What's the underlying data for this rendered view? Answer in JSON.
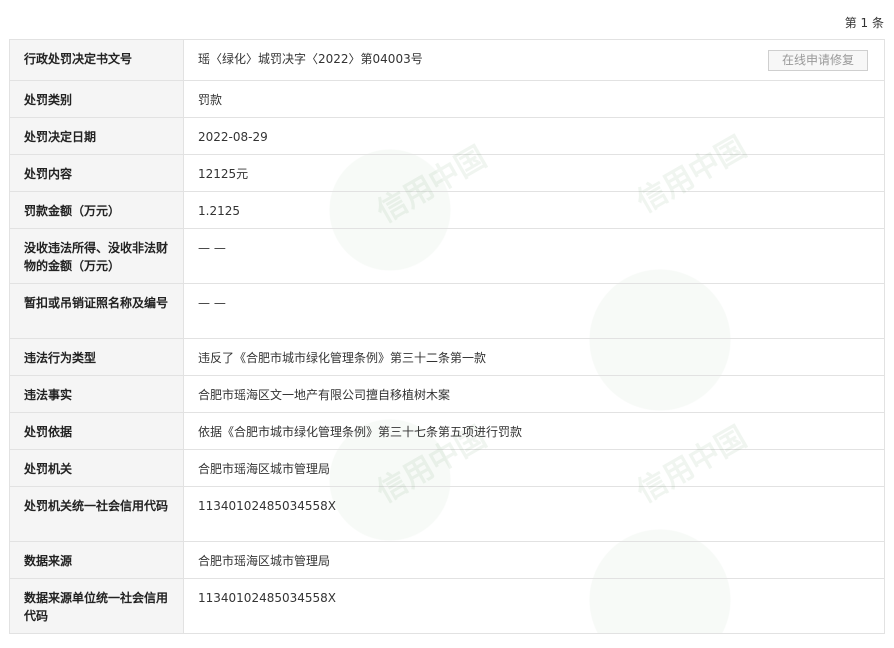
{
  "header": {
    "page_count": "第 1 条"
  },
  "repair_button": "在线申请修复",
  "watermark": "信用中国",
  "rows": [
    {
      "label": "行政处罚决定书文号",
      "value": "瑶〈绿化〉城罚决字〈2022〉第04003号"
    },
    {
      "label": "处罚类别",
      "value": "罚款"
    },
    {
      "label": "处罚决定日期",
      "value": "2022-08-29"
    },
    {
      "label": "处罚内容",
      "value": "12125元"
    },
    {
      "label": "罚款金额（万元）",
      "value": "1.2125"
    },
    {
      "label": "没收违法所得、没收非法财物的金额（万元）",
      "value": "— —"
    },
    {
      "label": "暂扣或吊销证照名称及编号",
      "value": "— —"
    },
    {
      "label": "违法行为类型",
      "value": "违反了《合肥市城市绿化管理条例》第三十二条第一款"
    },
    {
      "label": "违法事实",
      "value": "合肥市瑶海区文一地产有限公司擅自移植树木案"
    },
    {
      "label": "处罚依据",
      "value": "依据《合肥市城市绿化管理条例》第三十七条第五项进行罚款"
    },
    {
      "label": "处罚机关",
      "value": "合肥市瑶海区城市管理局"
    },
    {
      "label": "处罚机关统一社会信用代码",
      "value": "11340102485034558X"
    },
    {
      "label": "数据来源",
      "value": "合肥市瑶海区城市管理局"
    },
    {
      "label": "数据来源单位统一社会信用代码",
      "value": "11340102485034558X"
    }
  ]
}
